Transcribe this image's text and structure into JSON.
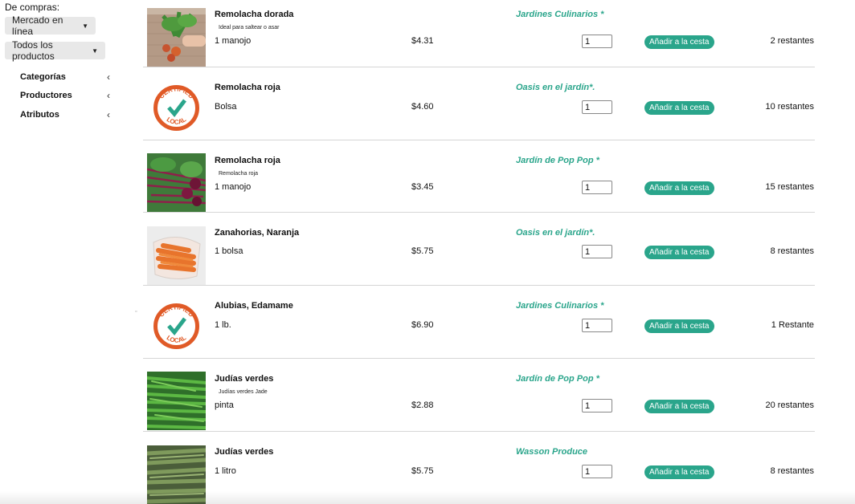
{
  "sidebar": {
    "shopping_label": "De compras:",
    "market_dropdown": "Mercado en línea",
    "products_dropdown": "Todos los productos",
    "links": [
      {
        "label": "Categorías"
      },
      {
        "label": "Productores"
      },
      {
        "label": "Atributos"
      }
    ]
  },
  "add_button_label": "Añadir a la cesta",
  "accent_color": "#2aa58b",
  "products": [
    {
      "name": "Remolacha dorada",
      "description": "Ideal para saltear o asar",
      "unit": "1 manojo",
      "price": "$4.31",
      "grower": "Jardines Culinarios *",
      "qty": "1",
      "stock": "2 restantes",
      "image": "golden-beets-photo"
    },
    {
      "name": "Remolacha roja",
      "description": "",
      "unit": "Bolsa",
      "price": "$4.60",
      "grower": "Oasis en el jardín*.",
      "qty": "1",
      "stock": "10 restantes",
      "image": "certified-local-logo",
      "logo_text": "CERTIFIED LOCAL"
    },
    {
      "name": "Remolacha roja",
      "description": "Remolacha roja",
      "unit": "1 manojo",
      "price": "$3.45",
      "grower": "Jardín de Pop Pop *",
      "qty": "1",
      "stock": "15 restantes",
      "image": "red-beets-photo"
    },
    {
      "name": "Zanahorias, Naranja",
      "description": "",
      "unit": "1 bolsa",
      "price": "$5.75",
      "grower": "Oasis en el jardín*.",
      "qty": "1",
      "stock": "8 restantes",
      "image": "carrots-bag-photo"
    },
    {
      "name": "Alubias, Edamame",
      "description": "",
      "unit": "1 lb.",
      "price": "$6.90",
      "grower": "Jardines Culinarios *",
      "qty": "1",
      "stock": "1 Restante",
      "image": "certified-local-logo",
      "logo_text": "CERTIFIED LOCAL"
    },
    {
      "name": "Judías verdes",
      "description": "Judías verdes Jade",
      "unit": "pinta",
      "price": "$2.88",
      "grower": "Jardín de Pop Pop *",
      "qty": "1",
      "stock": "20 restantes",
      "image": "green-beans-photo"
    },
    {
      "name": "Judías verdes",
      "description": "",
      "unit": "1 litro",
      "price": "$5.75",
      "grower": "Wasson Produce",
      "qty": "1",
      "stock": "8 restantes",
      "image": "green-beans-photo-2"
    }
  ]
}
